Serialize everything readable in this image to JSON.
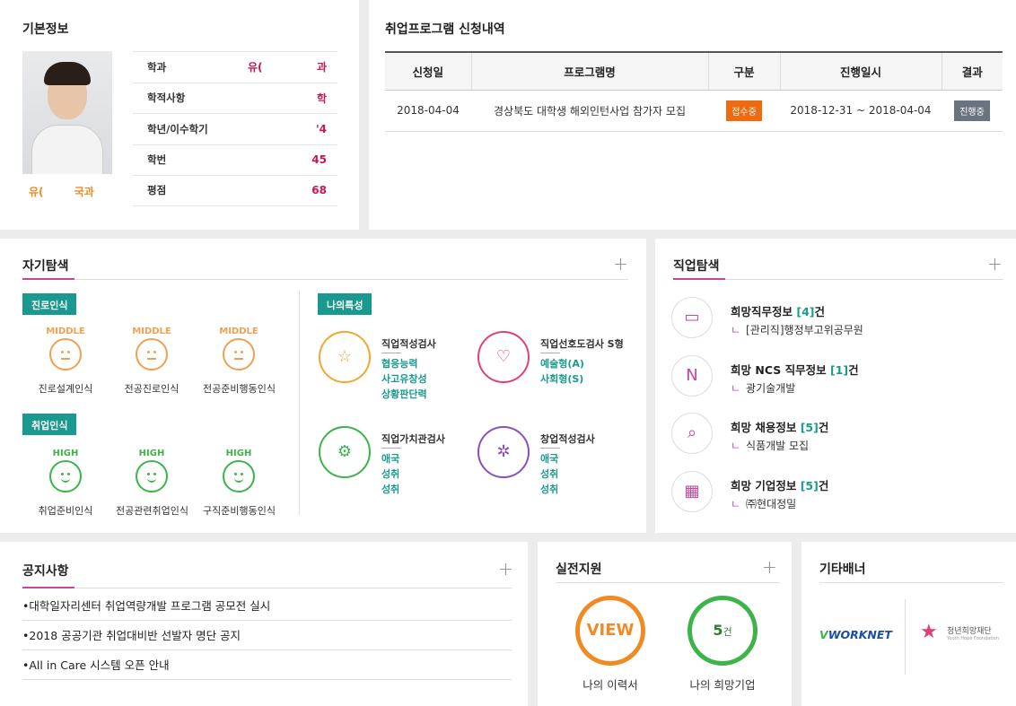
{
  "basic": {
    "title": "기본정보",
    "name_caption": "유( 국과",
    "rows": [
      {
        "key": "학과",
        "value": "유(",
        "value2": "과"
      },
      {
        "key": "학적사항",
        "value": "학"
      },
      {
        "key": "학년/이수학기",
        "value": "'4"
      },
      {
        "key": "학번",
        "value": "45"
      },
      {
        "key": "평점",
        "value": "68"
      }
    ]
  },
  "program": {
    "title": "취업프로그램 신청내역",
    "headers": [
      "신청일",
      "프로그램명",
      "구분",
      "진행일시",
      "결과"
    ],
    "rows": [
      {
        "date": "2018-04-04",
        "name": "경상북도 대학생 해외인턴사업 참가자 모집",
        "type": "접수중",
        "period": "2018-12-31 ~ 2018-04-04",
        "result": "진행중"
      }
    ]
  },
  "self": {
    "title": "자기탐색",
    "plus": "+",
    "tag1": "진로인식",
    "tag2": "취업인식",
    "tag3": "나의특성",
    "career": [
      {
        "level": "MIDDLE",
        "label": "진로설계인식"
      },
      {
        "level": "MIDDLE",
        "label": "전공진로인식"
      },
      {
        "level": "MIDDLE",
        "label": "전공준비행동인식"
      }
    ],
    "employ": [
      {
        "level": "HIGH",
        "label": "취업준비인식"
      },
      {
        "level": "HIGH",
        "label": "전공관련취업인식"
      },
      {
        "level": "HIGH",
        "label": "구직준비행동인식"
      }
    ],
    "tests": [
      {
        "name": "직업적성검사",
        "icon": "star-icon",
        "glyph": "☆",
        "color": "#f0a830",
        "results": [
          "협응능력",
          "사고유창성",
          "상황판단력"
        ]
      },
      {
        "name": "직업선호도검사 S형",
        "icon": "heart-icon",
        "glyph": "♡",
        "color": "#e0407a",
        "results": [
          "예술형(A)",
          "사회형(S)"
        ]
      },
      {
        "name": "직업가치관검사",
        "icon": "gear-head-icon",
        "glyph": "⚙",
        "color": "#3cb44a",
        "results": [
          "애국",
          "성취",
          "성취"
        ]
      },
      {
        "name": "창업적성검사",
        "icon": "network-icon",
        "glyph": "✲",
        "color": "#8a4fc0",
        "results": [
          "애국",
          "성취",
          "성취"
        ]
      }
    ]
  },
  "job": {
    "title": "직업탐색",
    "plus": "+",
    "items": [
      {
        "title": "희망직무정보",
        "count": "[4]",
        "suffix": "건",
        "sub": "[관리직]행정부고위공무원",
        "icon": "folder-icon",
        "glyph": "▭"
      },
      {
        "title": "희망 NCS 직무정보",
        "count": "[1]",
        "suffix": "건",
        "sub": "광기술개발",
        "icon": "ncs-icon",
        "glyph": "N"
      },
      {
        "title": "희망 채용정보",
        "count": "[5]",
        "suffix": "건",
        "sub": "식품개발 모집",
        "icon": "search-icon",
        "glyph": "⌕"
      },
      {
        "title": "희망 기업정보",
        "count": "[5]",
        "suffix": "건",
        "sub": "㈜현대정밀",
        "icon": "building-icon",
        "glyph": "▦"
      }
    ],
    "arrow": "ㄴ"
  },
  "notice": {
    "title": "공지사항",
    "plus": "+",
    "items": [
      "•대학일자리센터 취업역량개발 프로그램 공모전 실시",
      "•2018 공공기관 취업대비반 선발자 명단 공지",
      "•All in Care 시스템 오픈 안내"
    ]
  },
  "support": {
    "title": "실전지원",
    "plus": "+",
    "view": "VIEW",
    "count_num": "5",
    "count_unit": "건",
    "label1": "나의 이력서",
    "label2": "나의 희망기업"
  },
  "banner": {
    "title": "기타배너",
    "worknet": "WORKNET",
    "foundation": "청년희망재단",
    "foundation_en": "Youth Hope Foundation"
  },
  "colors": {
    "accent": "#c2489a",
    "teal": "#1a9a8e",
    "orange": "#f08a24",
    "green": "#3cb44a"
  }
}
